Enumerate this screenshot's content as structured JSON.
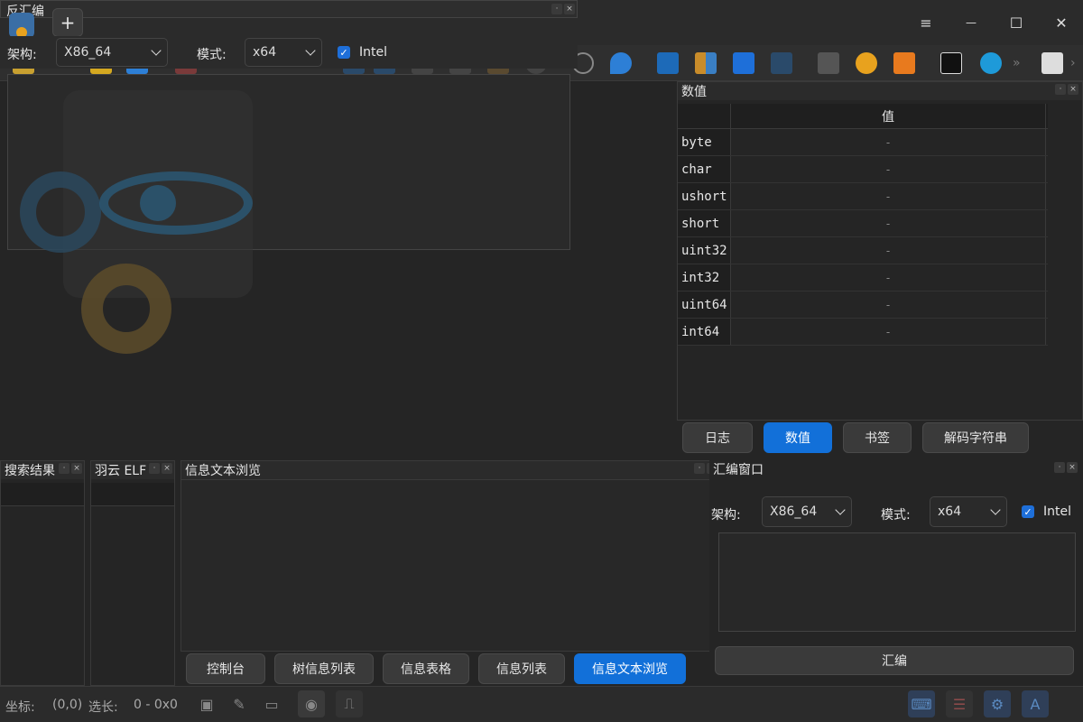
{
  "window": {
    "tab_title": "反汇编",
    "new_tab": "+",
    "menu_icon": "≡",
    "minimize": "—",
    "maximize": "☐",
    "close": "✕"
  },
  "asm_top": {
    "arch_label": "架构:",
    "arch_value": "X86_64",
    "mode_label": "模式:",
    "mode_value": "x64",
    "intel_label": "Intel"
  },
  "value_panel": {
    "title": "数值",
    "column_header": "值",
    "rows": [
      {
        "type": "byte",
        "value": "-"
      },
      {
        "type": "char",
        "value": "-"
      },
      {
        "type": "ushort",
        "value": "-"
      },
      {
        "type": "short",
        "value": "-"
      },
      {
        "type": "uint32",
        "value": "-"
      },
      {
        "type": "int32",
        "value": "-"
      },
      {
        "type": "uint64",
        "value": "-"
      },
      {
        "type": "int64",
        "value": "-"
      }
    ],
    "tabs": [
      "日志",
      "数值",
      "书签",
      "解码字符串"
    ],
    "active_tab": "数值"
  },
  "search_panel": {
    "title": "搜索结果"
  },
  "elf_panel": {
    "title": "羽云 ELF"
  },
  "info_panel": {
    "title": "信息文本浏览",
    "tabs": [
      "控制台",
      "树信息列表",
      "信息表格",
      "信息列表",
      "信息文本浏览"
    ],
    "active_tab": "信息文本浏览"
  },
  "asm_panel": {
    "title": "汇编窗口",
    "arch_label": "架构:",
    "arch_value": "X86_64",
    "mode_label": "模式:",
    "mode_value": "x64",
    "intel_label": "Intel",
    "assemble_button": "汇编"
  },
  "status": {
    "coord_label": "坐标:",
    "coord_value": "(0,0)",
    "sel_label": "选长:",
    "sel_value": "0 - 0x0"
  },
  "colors": {
    "accent": "#1270d9",
    "bg": "#252525",
    "panel_header": "#2b2b2b"
  }
}
